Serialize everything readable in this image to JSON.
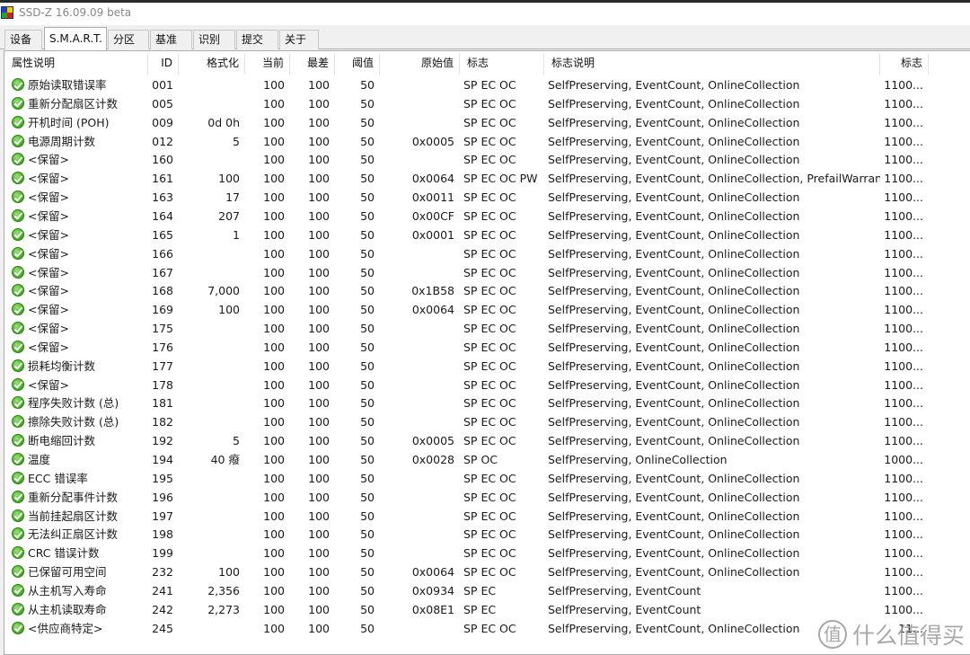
{
  "window": {
    "title": "SSD-Z 16.09.09 beta"
  },
  "tabs": [
    {
      "label": "设备",
      "active": false
    },
    {
      "label": "S.M.A.R.T.",
      "active": true
    },
    {
      "label": "分区",
      "active": false
    },
    {
      "label": "基准",
      "active": false
    },
    {
      "label": "识别",
      "active": false
    },
    {
      "label": "提交",
      "active": false
    },
    {
      "label": "关于",
      "active": false
    }
  ],
  "table": {
    "columns": [
      "属性说明",
      "ID",
      "格式化",
      "当前",
      "最差",
      "阈值",
      "原始值",
      "标志",
      "标志说明",
      "标志"
    ],
    "status_icon": "check-circle-icon",
    "status_color": "#4fb82c",
    "rows": [
      [
        "原始读取错误率",
        "001",
        "",
        "100",
        "100",
        "50",
        "",
        "SP EC OC",
        "SelfPreserving, EventCount, OnlineCollection",
        "1100..."
      ],
      [
        "重新分配扇区计数",
        "005",
        "",
        "100",
        "100",
        "50",
        "",
        "SP EC OC",
        "SelfPreserving, EventCount, OnlineCollection",
        "1100..."
      ],
      [
        "开机时间 (POH)",
        "009",
        "0d 0h",
        "100",
        "100",
        "50",
        "",
        "SP EC OC",
        "SelfPreserving, EventCount, OnlineCollection",
        "1100..."
      ],
      [
        "电源周期计数",
        "012",
        "5",
        "100",
        "100",
        "50",
        "0x0005",
        "SP EC OC",
        "SelfPreserving, EventCount, OnlineCollection",
        "1100..."
      ],
      [
        "<保留>",
        "160",
        "",
        "100",
        "100",
        "50",
        "",
        "SP EC OC",
        "SelfPreserving, EventCount, OnlineCollection",
        "1100..."
      ],
      [
        "<保留>",
        "161",
        "100",
        "100",
        "100",
        "50",
        "0x0064",
        "SP EC OC PW",
        "SelfPreserving, EventCount, OnlineCollection, PrefailWarranty",
        "1100..."
      ],
      [
        "<保留>",
        "163",
        "17",
        "100",
        "100",
        "50",
        "0x0011",
        "SP EC OC",
        "SelfPreserving, EventCount, OnlineCollection",
        "1100..."
      ],
      [
        "<保留>",
        "164",
        "207",
        "100",
        "100",
        "50",
        "0x00CF",
        "SP EC OC",
        "SelfPreserving, EventCount, OnlineCollection",
        "1100..."
      ],
      [
        "<保留>",
        "165",
        "1",
        "100",
        "100",
        "50",
        "0x0001",
        "SP EC OC",
        "SelfPreserving, EventCount, OnlineCollection",
        "1100..."
      ],
      [
        "<保留>",
        "166",
        "",
        "100",
        "100",
        "50",
        "",
        "SP EC OC",
        "SelfPreserving, EventCount, OnlineCollection",
        "1100..."
      ],
      [
        "<保留>",
        "167",
        "",
        "100",
        "100",
        "50",
        "",
        "SP EC OC",
        "SelfPreserving, EventCount, OnlineCollection",
        "1100..."
      ],
      [
        "<保留>",
        "168",
        "7,000",
        "100",
        "100",
        "50",
        "0x1B58",
        "SP EC OC",
        "SelfPreserving, EventCount, OnlineCollection",
        "1100..."
      ],
      [
        "<保留>",
        "169",
        "100",
        "100",
        "100",
        "50",
        "0x0064",
        "SP EC OC",
        "SelfPreserving, EventCount, OnlineCollection",
        "1100..."
      ],
      [
        "<保留>",
        "175",
        "",
        "100",
        "100",
        "50",
        "",
        "SP EC OC",
        "SelfPreserving, EventCount, OnlineCollection",
        "1100..."
      ],
      [
        "<保留>",
        "176",
        "",
        "100",
        "100",
        "50",
        "",
        "SP EC OC",
        "SelfPreserving, EventCount, OnlineCollection",
        "1100..."
      ],
      [
        "损耗均衡计数",
        "177",
        "",
        "100",
        "100",
        "50",
        "",
        "SP EC OC",
        "SelfPreserving, EventCount, OnlineCollection",
        "1100..."
      ],
      [
        "<保留>",
        "178",
        "",
        "100",
        "100",
        "50",
        "",
        "SP EC OC",
        "SelfPreserving, EventCount, OnlineCollection",
        "1100..."
      ],
      [
        "程序失败计数 (总)",
        "181",
        "",
        "100",
        "100",
        "50",
        "",
        "SP EC OC",
        "SelfPreserving, EventCount, OnlineCollection",
        "1100..."
      ],
      [
        "擦除失败计数 (总)",
        "182",
        "",
        "100",
        "100",
        "50",
        "",
        "SP EC OC",
        "SelfPreserving, EventCount, OnlineCollection",
        "1100..."
      ],
      [
        "断电缩回计数",
        "192",
        "5",
        "100",
        "100",
        "50",
        "0x0005",
        "SP EC OC",
        "SelfPreserving, EventCount, OnlineCollection",
        "1100..."
      ],
      [
        "温度",
        "194",
        "40 癈",
        "100",
        "100",
        "50",
        "0x0028",
        "SP OC",
        "SelfPreserving, OnlineCollection",
        "1000..."
      ],
      [
        "ECC 错误率",
        "195",
        "",
        "100",
        "100",
        "50",
        "",
        "SP EC OC",
        "SelfPreserving, EventCount, OnlineCollection",
        "1100..."
      ],
      [
        "重新分配事件计数",
        "196",
        "",
        "100",
        "100",
        "50",
        "",
        "SP EC OC",
        "SelfPreserving, EventCount, OnlineCollection",
        "1100..."
      ],
      [
        "当前挂起扇区计数",
        "197",
        "",
        "100",
        "100",
        "50",
        "",
        "SP EC OC",
        "SelfPreserving, EventCount, OnlineCollection",
        "1100..."
      ],
      [
        "无法纠正扇区计数",
        "198",
        "",
        "100",
        "100",
        "50",
        "",
        "SP EC OC",
        "SelfPreserving, EventCount, OnlineCollection",
        "1100..."
      ],
      [
        "CRC 错误计数",
        "199",
        "",
        "100",
        "100",
        "50",
        "",
        "SP EC OC",
        "SelfPreserving, EventCount, OnlineCollection",
        "1100..."
      ],
      [
        "已保留可用空间",
        "232",
        "100",
        "100",
        "100",
        "50",
        "0x0064",
        "SP EC OC",
        "SelfPreserving, EventCount, OnlineCollection",
        "1100..."
      ],
      [
        "从主机写入寿命",
        "241",
        "2,356",
        "100",
        "100",
        "50",
        "0x0934",
        "SP EC",
        "SelfPreserving, EventCount",
        "1100..."
      ],
      [
        "从主机读取寿命",
        "242",
        "2,273",
        "100",
        "100",
        "50",
        "0x08E1",
        "SP EC",
        "SelfPreserving, EventCount",
        "1100..."
      ],
      [
        "<供应商特定>",
        "245",
        "",
        "100",
        "100",
        "50",
        "",
        "SP EC OC",
        "SelfPreserving, EventCount, OnlineCollection",
        "11..."
      ]
    ]
  },
  "watermark": {
    "logo_text": "值",
    "text": "什么值得买"
  }
}
